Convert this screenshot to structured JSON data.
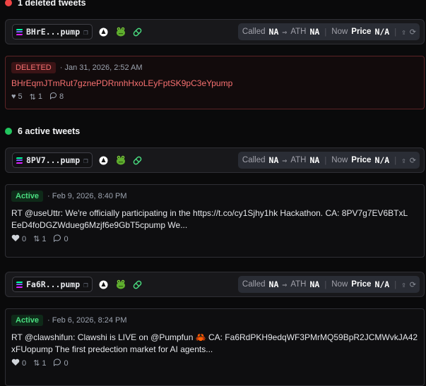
{
  "deleted_section": {
    "title": "1 deleted tweets"
  },
  "active_section": {
    "title": "6 active tweets"
  },
  "stats_labels": {
    "called": "Called",
    "ath": "ATH",
    "now": "Now",
    "price": "Price"
  },
  "tokens": [
    {
      "symbol": "BHrE...pump",
      "called": "NA",
      "ath": "NA",
      "price": "N/A"
    },
    {
      "symbol": "8PV7...pump",
      "called": "NA",
      "ath": "NA",
      "price": "N/A"
    },
    {
      "symbol": "Fa6R...pump",
      "called": "NA",
      "ath": "NA",
      "price": "N/A"
    }
  ],
  "deleted_tweet": {
    "badge": "DELETED",
    "date": "· Jan 31, 2026, 2:52 AM",
    "text": "BHrEqmJTmRut7gznePDRnnhHxoLEyFptSK9pC3eYpump",
    "likes": "5",
    "retweets": "1",
    "replies": "8"
  },
  "active_tweets": [
    {
      "badge": "Active",
      "date": "· Feb 9, 2026, 8:40 PM",
      "line1": "RT @useUttr: We're officially participating in the https://t.co/cy1Sjhy1hk Hackathon. CA: 8PV7g7EV6BTxL",
      "line2": "EeD4foDGZWdueg6Mzjf6e9GbT5cpump We...",
      "likes": "0",
      "retweets": "1",
      "replies": "0"
    },
    {
      "badge": "Active",
      "date": "· Feb 6, 2026, 8:24 PM",
      "line1": "RT @clawshifun: Clawshi is LIVE on @Pumpfun 🦀 CA: Fa6RdPKH9edqWF3PMrMQ59BpR2JCMWvkJA42",
      "line2": "xFUopump The first predection market for AI agents...",
      "likes": "0",
      "retweets": "1",
      "replies": "0"
    }
  ],
  "icons": {
    "arrow": "⇒",
    "copy": "❐",
    "share": "⇪",
    "refresh": "⟳",
    "like_solid": "♥",
    "like_outline": "🤍",
    "retweet": "⇅",
    "reply": "💬"
  },
  "colors": {
    "background": "#0a0a0b",
    "deleted": "#f87171",
    "active": "#4ade80",
    "red_dot": "#ef4444",
    "green_dot": "#22c55e"
  }
}
